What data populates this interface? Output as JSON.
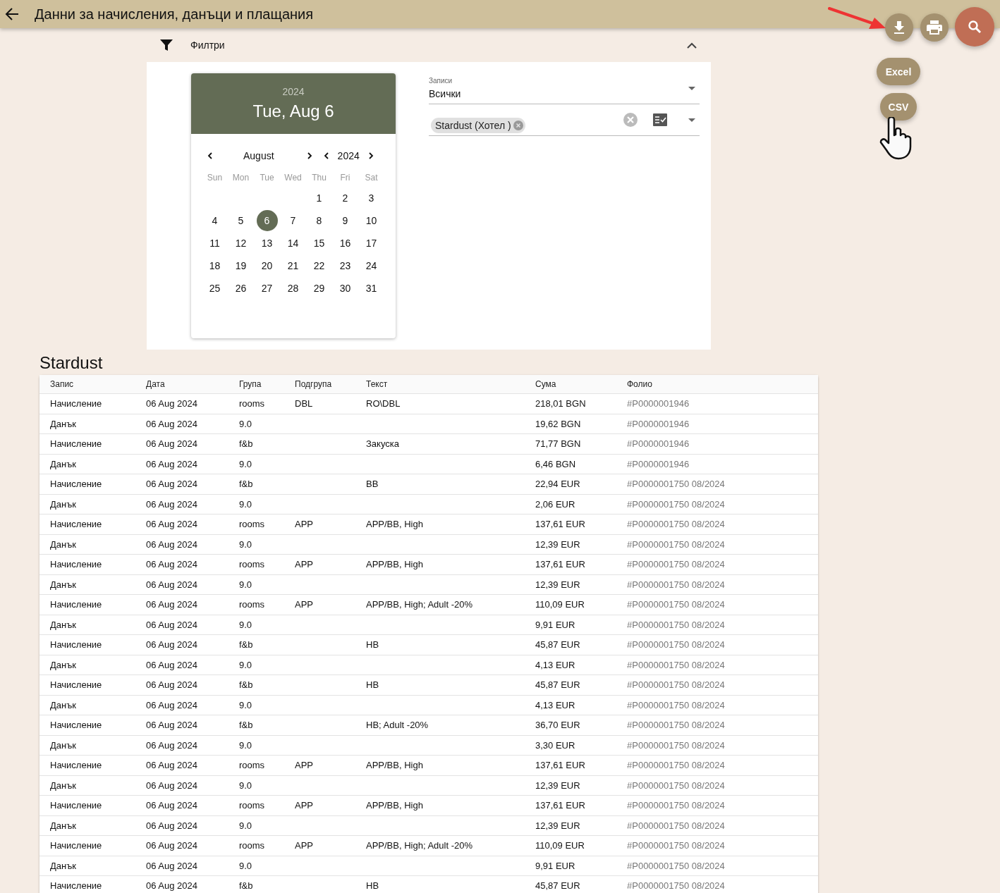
{
  "header": {
    "title": "Данни за начисления, данъци и плащания"
  },
  "actions": {
    "fabs": [
      {
        "kind": "download"
      },
      {
        "kind": "print"
      },
      {
        "kind": "search"
      }
    ],
    "export_options": [
      "Excel",
      "CSV"
    ]
  },
  "filters": {
    "label": "Филтри",
    "expanded": true,
    "calendar": {
      "year": "2024",
      "date": "Tue, Aug 6",
      "month": "August",
      "nav_year": "2024",
      "weekdays": [
        "Sun",
        "Mon",
        "Tue",
        "Wed",
        "Thu",
        "Fri",
        "Sat"
      ],
      "weeks": [
        [
          {
            "label": "1",
            "selected": false
          },
          {
            "label": "2",
            "selected": false
          },
          {
            "label": "3",
            "selected": false
          }
        ],
        [
          {
            "label": "4",
            "selected": false
          },
          {
            "label": "5",
            "selected": false
          },
          {
            "label": "6",
            "selected": true
          },
          {
            "label": "7",
            "selected": false
          },
          {
            "label": "8",
            "selected": false
          },
          {
            "label": "9",
            "selected": false
          },
          {
            "label": "10",
            "selected": false
          }
        ],
        [
          {
            "label": "11",
            "selected": false
          },
          {
            "label": "12",
            "selected": false
          },
          {
            "label": "13",
            "selected": false
          },
          {
            "label": "14",
            "selected": false
          },
          {
            "label": "15",
            "selected": false
          },
          {
            "label": "16",
            "selected": false
          },
          {
            "label": "17",
            "selected": false
          }
        ],
        [
          {
            "label": "18",
            "selected": false
          },
          {
            "label": "19",
            "selected": false
          },
          {
            "label": "20",
            "selected": false
          },
          {
            "label": "21",
            "selected": false
          },
          {
            "label": "22",
            "selected": false
          },
          {
            "label": "23",
            "selected": false
          },
          {
            "label": "24",
            "selected": false
          }
        ],
        [
          {
            "label": "25",
            "selected": false
          },
          {
            "label": "26",
            "selected": false
          },
          {
            "label": "27",
            "selected": false
          },
          {
            "label": "28",
            "selected": false
          },
          {
            "label": "29",
            "selected": false
          },
          {
            "label": "30",
            "selected": false
          },
          {
            "label": "31",
            "selected": false
          }
        ]
      ]
    },
    "records_select": {
      "label": "Записи",
      "value": "Всички"
    },
    "hotel_select": {
      "chips": [
        "Stardust (Хотел )"
      ]
    }
  },
  "table": {
    "title": "Stardust",
    "columns": [
      "Запис",
      "Дата",
      "Група",
      "Подгрупа",
      "Текст",
      "Сума",
      "Фолио"
    ],
    "rows": [
      [
        "Начисление",
        "06 Aug 2024",
        "rooms",
        "DBL",
        "RO\\DBL",
        "218,01 BGN",
        "#P0000001946"
      ],
      [
        "Данък",
        "06 Aug 2024",
        "9.0",
        null,
        null,
        "19,62 BGN",
        "#P0000001946"
      ],
      [
        "Начисление",
        "06 Aug 2024",
        "f&b",
        null,
        "Закуска",
        "71,77 BGN",
        "#P0000001946"
      ],
      [
        "Данък",
        "06 Aug 2024",
        "9.0",
        null,
        null,
        "6,46 BGN",
        "#P0000001946"
      ],
      [
        "Начисление",
        "06 Aug 2024",
        "f&b",
        null,
        "BB",
        "22,94 EUR",
        "#P0000001750 08/2024"
      ],
      [
        "Данък",
        "06 Aug 2024",
        "9.0",
        null,
        null,
        "2,06 EUR",
        "#P0000001750 08/2024"
      ],
      [
        "Начисление",
        "06 Aug 2024",
        "rooms",
        "APP",
        "APP/BB, High",
        "137,61 EUR",
        "#P0000001750 08/2024"
      ],
      [
        "Данък",
        "06 Aug 2024",
        "9.0",
        null,
        null,
        "12,39 EUR",
        "#P0000001750 08/2024"
      ],
      [
        "Начисление",
        "06 Aug 2024",
        "rooms",
        "APP",
        "APP/BB, High",
        "137,61 EUR",
        "#P0000001750 08/2024"
      ],
      [
        "Данък",
        "06 Aug 2024",
        "9.0",
        null,
        null,
        "12,39 EUR",
        "#P0000001750 08/2024"
      ],
      [
        "Начисление",
        "06 Aug 2024",
        "rooms",
        "APP",
        "APP/BB, High; Adult -20%",
        "110,09 EUR",
        "#P0000001750 08/2024"
      ],
      [
        "Данък",
        "06 Aug 2024",
        "9.0",
        null,
        null,
        "9,91 EUR",
        "#P0000001750 08/2024"
      ],
      [
        "Начисление",
        "06 Aug 2024",
        "f&b",
        null,
        "HB",
        "45,87 EUR",
        "#P0000001750 08/2024"
      ],
      [
        "Данък",
        "06 Aug 2024",
        "9.0",
        null,
        null,
        "4,13 EUR",
        "#P0000001750 08/2024"
      ],
      [
        "Начисление",
        "06 Aug 2024",
        "f&b",
        null,
        "HB",
        "45,87 EUR",
        "#P0000001750 08/2024"
      ],
      [
        "Данък",
        "06 Aug 2024",
        "9.0",
        null,
        null,
        "4,13 EUR",
        "#P0000001750 08/2024"
      ],
      [
        "Начисление",
        "06 Aug 2024",
        "f&b",
        null,
        "HB; Adult -20%",
        "36,70 EUR",
        "#P0000001750 08/2024"
      ],
      [
        "Данък",
        "06 Aug 2024",
        "9.0",
        null,
        null,
        "3,30 EUR",
        "#P0000001750 08/2024"
      ],
      [
        "Начисление",
        "06 Aug 2024",
        "rooms",
        "APP",
        "APP/BB, High",
        "137,61 EUR",
        "#P0000001750 08/2024"
      ],
      [
        "Данък",
        "06 Aug 2024",
        "9.0",
        null,
        null,
        "12,39 EUR",
        "#P0000001750 08/2024"
      ],
      [
        "Начисление",
        "06 Aug 2024",
        "rooms",
        "APP",
        "APP/BB, High",
        "137,61 EUR",
        "#P0000001750 08/2024"
      ],
      [
        "Данък",
        "06 Aug 2024",
        "9.0",
        null,
        null,
        "12,39 EUR",
        "#P0000001750 08/2024"
      ],
      [
        "Начисление",
        "06 Aug 2024",
        "rooms",
        "APP",
        "APP/BB, High; Adult -20%",
        "110,09 EUR",
        "#P0000001750 08/2024"
      ],
      [
        "Данък",
        "06 Aug 2024",
        "9.0",
        null,
        null,
        "9,91 EUR",
        "#P0000001750 08/2024"
      ],
      [
        "Начисление",
        "06 Aug 2024",
        "f&b",
        null,
        "HB",
        "45,87 EUR",
        "#P0000001750 08/2024"
      ]
    ]
  }
}
